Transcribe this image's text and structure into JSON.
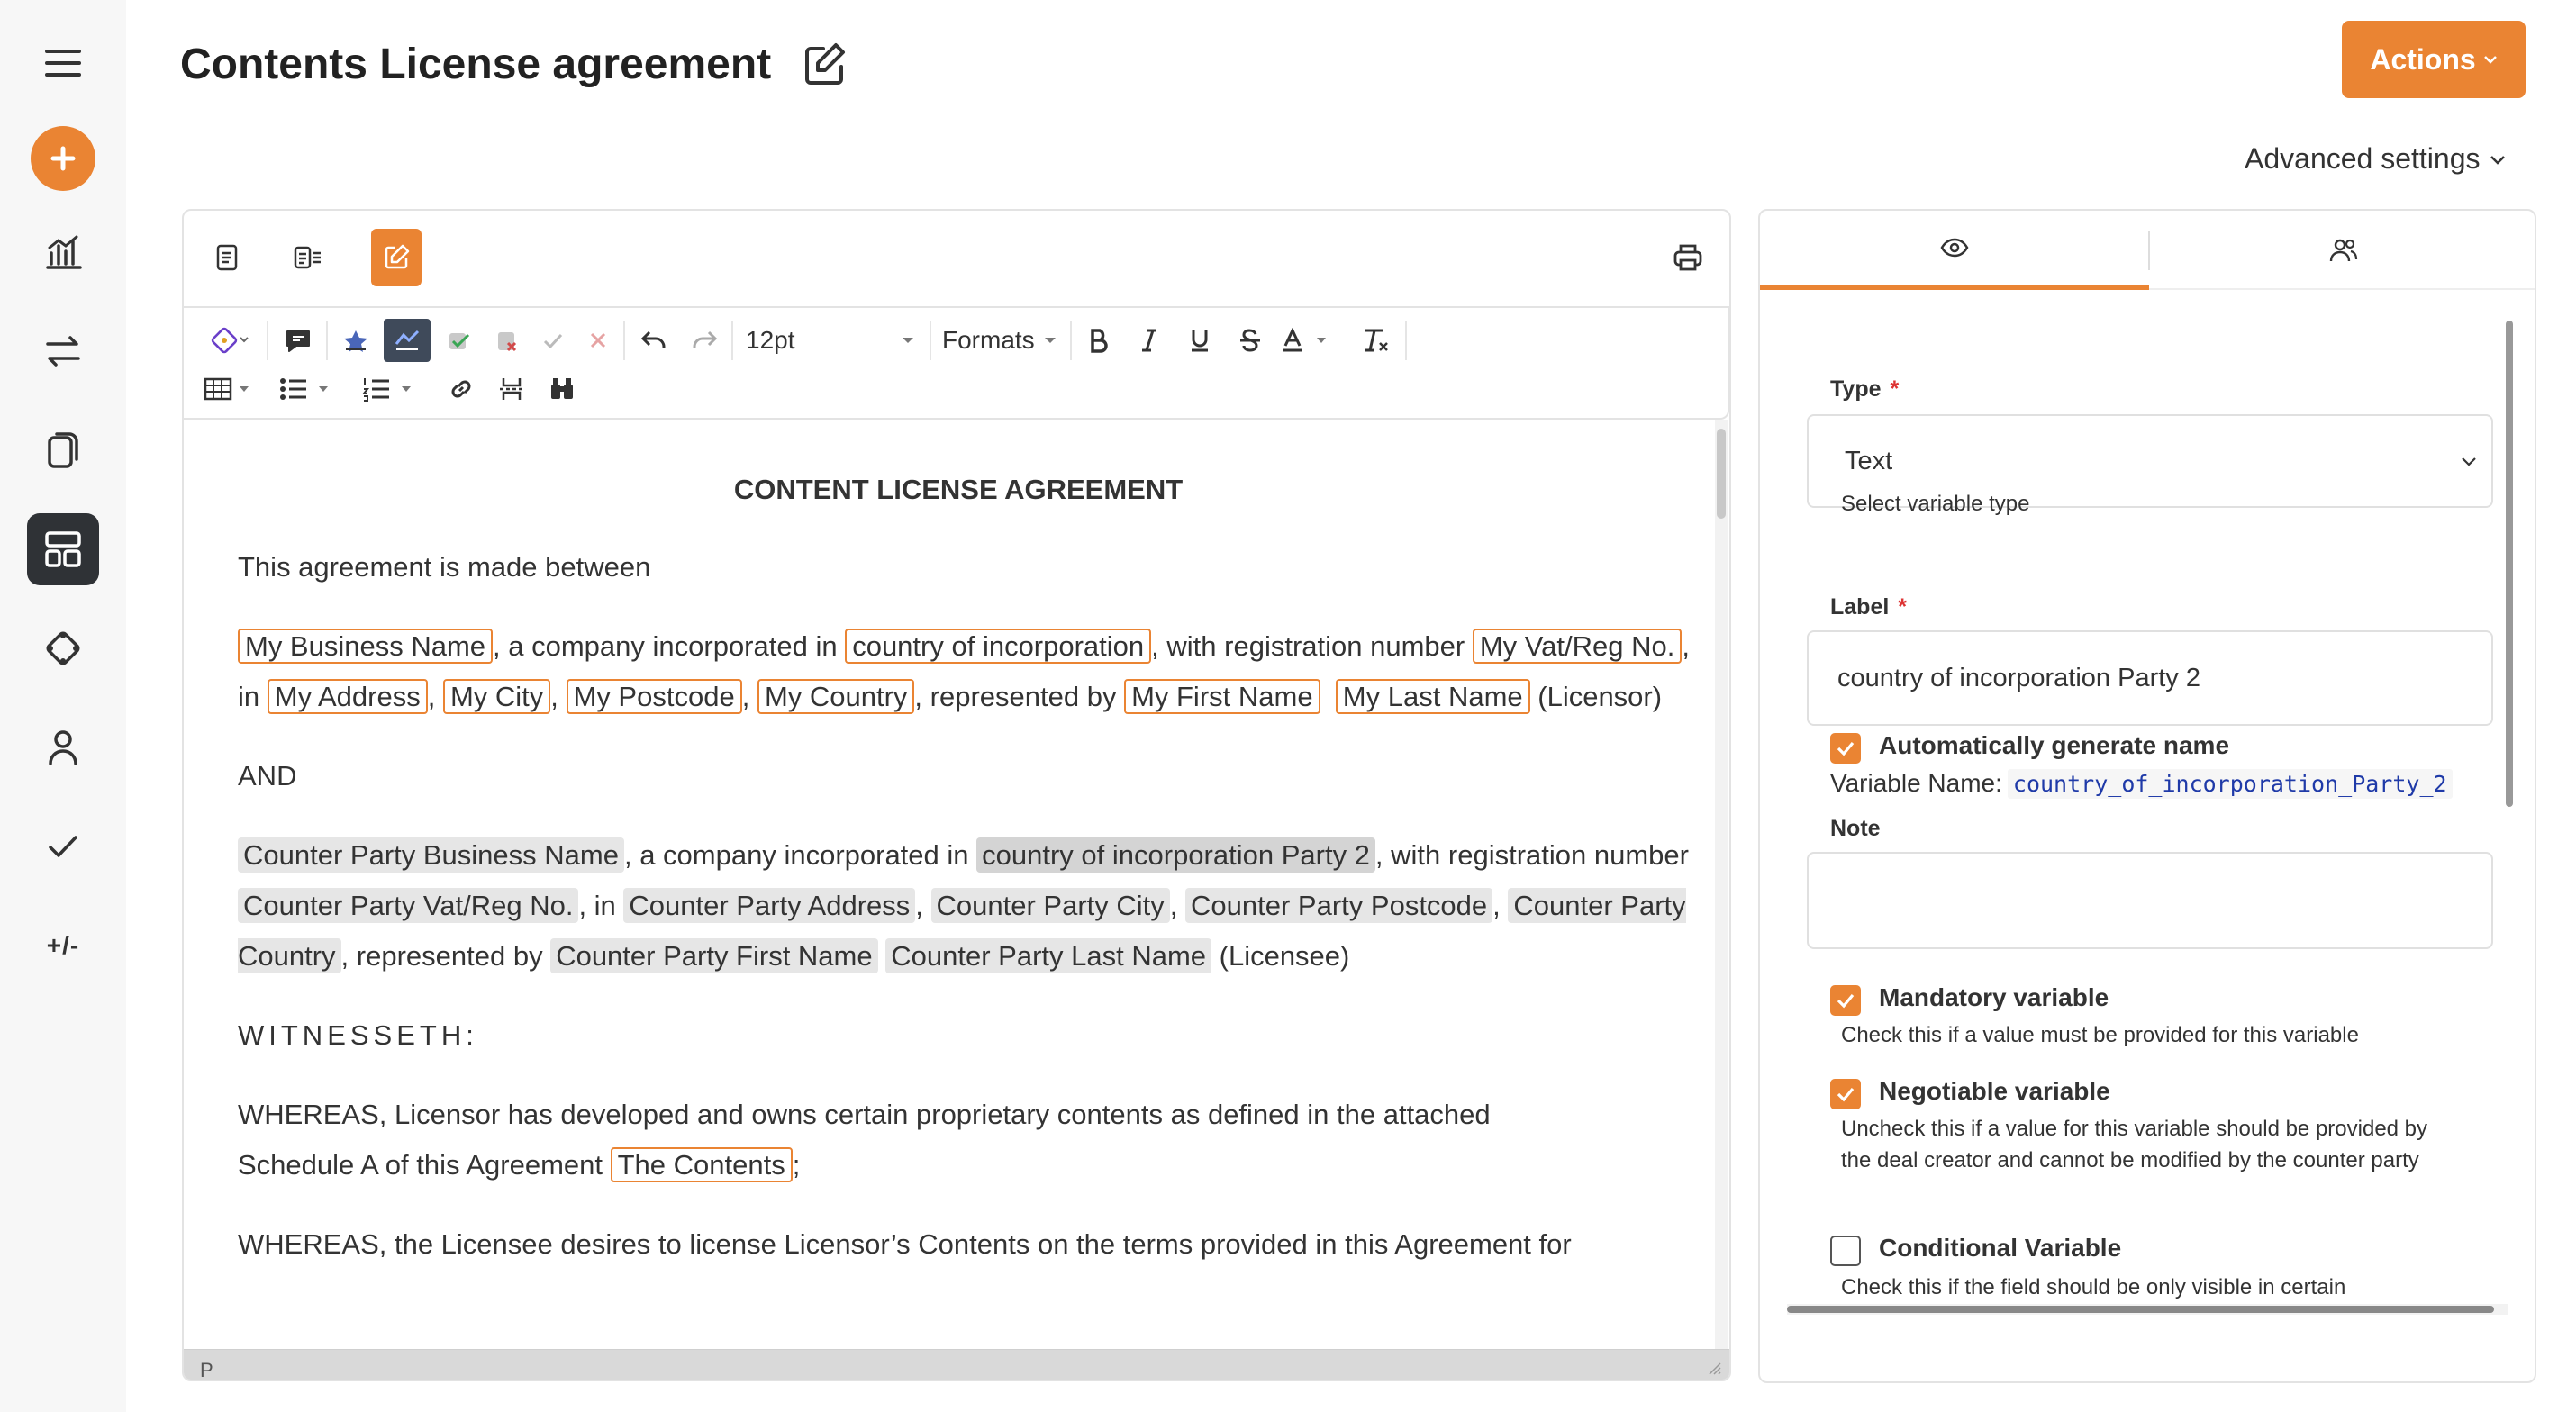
{
  "header": {
    "title": "Contents License agreement",
    "actions_label": "Actions",
    "advanced_settings_label": "Advanced settings"
  },
  "rail": {
    "items": [
      "menu-icon",
      "create-icon",
      "analytics-icon",
      "transfer-icon",
      "documents-icon",
      "templates-icon",
      "integrations-icon",
      "user-icon",
      "approvals-icon"
    ],
    "diff_label": "+/-"
  },
  "toolbar": {
    "font_size": "12pt",
    "formats_label": "Formats"
  },
  "document": {
    "heading": "CONTENT LICENSE AGREEMENT",
    "intro": "This agreement is made  between",
    "p1": {
      "my_business_name": "My Business Name",
      "t1": ", a company incorporated in ",
      "country_of_incorporation": "country of incorporation",
      "t2": ", with registration number ",
      "my_vat_reg": "My Vat/Reg No.",
      "t3": ", in ",
      "my_address": "My Address",
      "my_city": "My City",
      "my_postcode": "My Postcode",
      "my_country": "My Country",
      "t4": ", represented by ",
      "my_first_name": "My First Name",
      "my_last_name": "My Last Name",
      "t5": " (Licensor)"
    },
    "and": "AND",
    "p2": {
      "cp_business_name": "Counter Party Business Name",
      "t1": ", a company incorporated in ",
      "cp_country_of_incorporation": "country of incorporation Party 2",
      "t2": ", with registration number ",
      "cp_vat_reg": "Counter Party Vat/Reg No.",
      "t3": ", in ",
      "cp_address": "Counter Party Address",
      "cp_city": "Counter Party City",
      "cp_postcode": "Counter Party Postcode",
      "cp_country": "Counter Party Country",
      "t4": ", represented by ",
      "cp_first_name": "Counter Party First Name",
      "cp_last_name": "Counter Party Last Name",
      "t5": " (Licensee)"
    },
    "witnesseth": "WITNESSETH:",
    "whereas1": "WHEREAS, Licensor has developed and owns certain proprietary contents as defined in the attached Schedule A of this Agreement ",
    "the_contents": "The Contents",
    "whereas1_end": ";",
    "whereas2": "WHEREAS, the  Licensee desires to license  Licensor’s Contents on the terms provided in this Agreement for",
    "status_path": "P"
  },
  "settings": {
    "type_label": "Type",
    "type_value": "Text",
    "type_help": "Select variable type",
    "label_label": "Label",
    "label_value": "country of incorporation Party 2",
    "auto_name_label": "Automatically generate name",
    "variable_name_prefix": "Variable Name:",
    "variable_name": "country_of_incorporation_Party_2",
    "note_label": "Note",
    "note_value": "",
    "mandatory_label": "Mandatory variable",
    "mandatory_help": "Check this if a value must be provided for this variable",
    "negotiable_label": "Negotiable variable",
    "negotiable_help": "Uncheck this if a value for this variable should be provided by the deal creator and cannot be modified by the counter party",
    "conditional_label": "Conditional Variable",
    "conditional_help": "Check this if the field should be only visible in certain",
    "required_mark": "*",
    "auto_name_checked": true,
    "mandatory_checked": true,
    "negotiable_checked": true,
    "conditional_checked": false
  },
  "colors": {
    "accent": "#ea8433",
    "variable_highlight": "#e6e6e6",
    "code_text": "#1f3aa8"
  }
}
